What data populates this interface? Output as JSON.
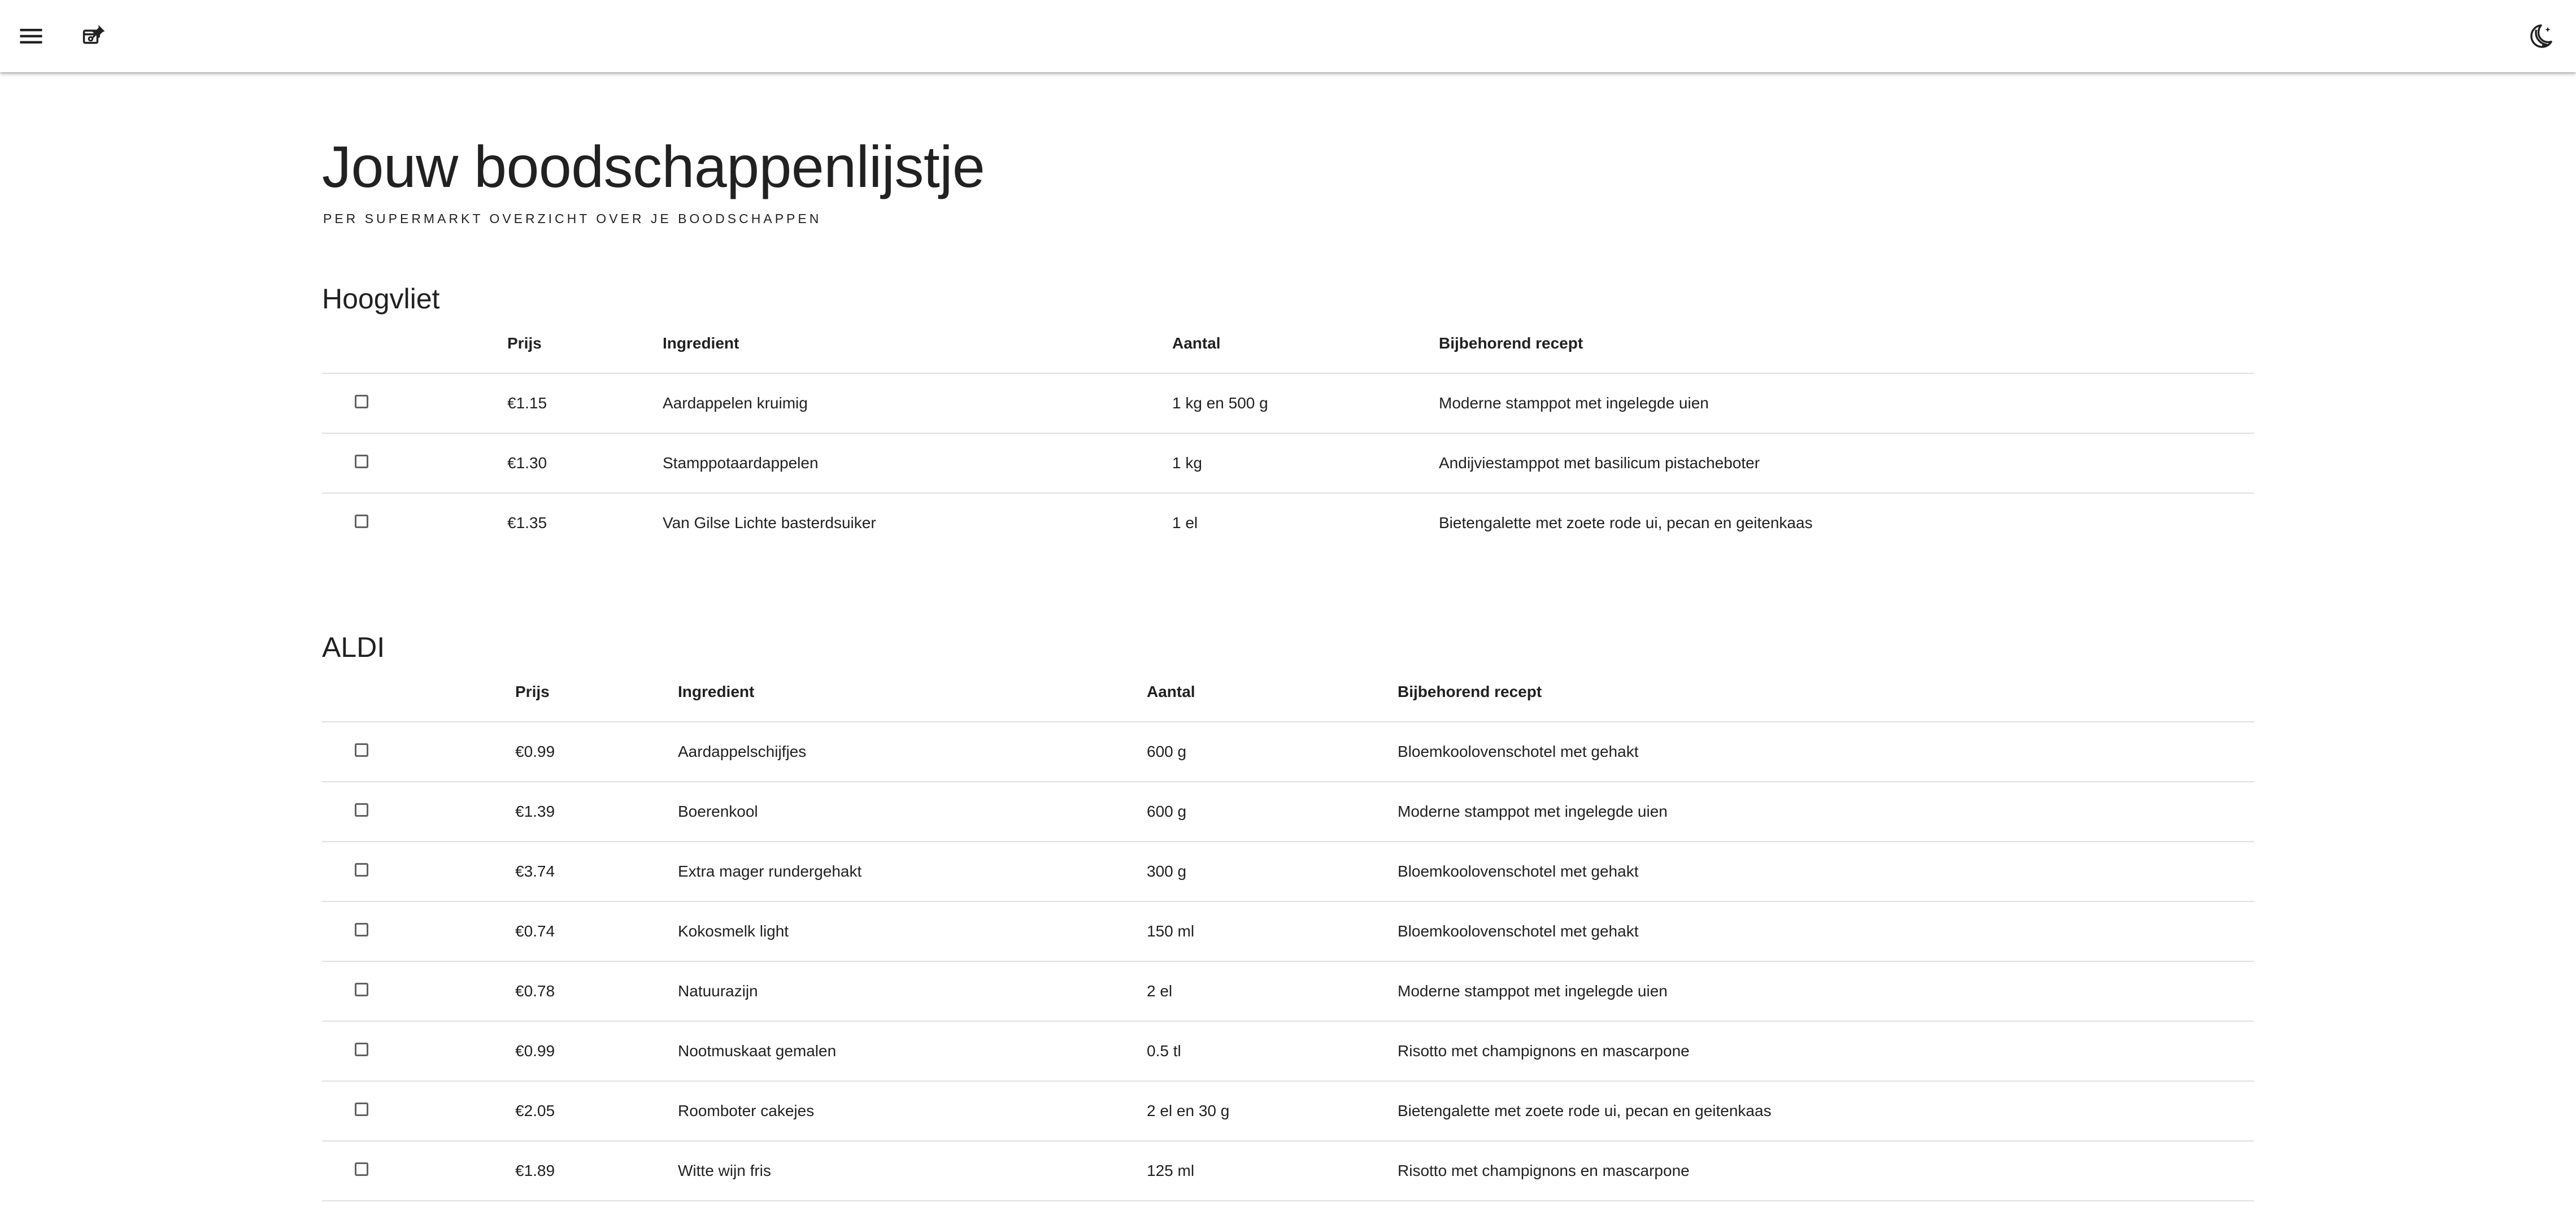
{
  "toolbar": {
    "menu_icon": "menu-icon",
    "pin_icon": "calendar-pin-icon",
    "theme_icon": "moon-icon"
  },
  "page": {
    "title": "Jouw boodschappenlijstje",
    "subtitle": "PER SUPERMARKT OVERZICHT OVER JE BOODSCHAPPEN"
  },
  "columns": {
    "prijs": "Prijs",
    "ingredient": "Ingredient",
    "aantal": "Aantal",
    "recept": "Bijbehorend recept"
  },
  "stores": [
    {
      "name": "Hoogvliet",
      "rows": [
        {
          "prijs": "€1.15",
          "ingredient": "Aardappelen kruimig",
          "aantal": "1 kg en 500 g",
          "recept": "Moderne stamppot met ingelegde uien",
          "checked": false
        },
        {
          "prijs": "€1.30",
          "ingredient": "Stamppotaardappelen",
          "aantal": "1 kg",
          "recept": "Andijviestamppot met basilicum pistacheboter",
          "checked": false
        },
        {
          "prijs": "€1.35",
          "ingredient": "Van Gilse Lichte basterdsuiker",
          "aantal": "1 el",
          "recept": "Bietengalette met zoete rode ui, pecan en geitenkaas",
          "checked": false
        }
      ]
    },
    {
      "name": "ALDI",
      "rows": [
        {
          "prijs": "€0.99",
          "ingredient": "Aardappelschijfjes",
          "aantal": "600 g",
          "recept": "Bloemkoolovenschotel met gehakt",
          "checked": false
        },
        {
          "prijs": "€1.39",
          "ingredient": "Boerenkool",
          "aantal": "600 g",
          "recept": "Moderne stamppot met ingelegde uien",
          "checked": false
        },
        {
          "prijs": "€3.74",
          "ingredient": "Extra mager rundergehakt",
          "aantal": "300 g",
          "recept": "Bloemkoolovenschotel met gehakt",
          "checked": false
        },
        {
          "prijs": "€0.74",
          "ingredient": "Kokosmelk light",
          "aantal": "150 ml",
          "recept": "Bloemkoolovenschotel met gehakt",
          "checked": false
        },
        {
          "prijs": "€0.78",
          "ingredient": "Natuurazijn",
          "aantal": "2 el",
          "recept": "Moderne stamppot met ingelegde uien",
          "checked": false
        },
        {
          "prijs": "€0.99",
          "ingredient": "Nootmuskaat gemalen",
          "aantal": "0.5 tl",
          "recept": "Risotto met champignons en mascarpone",
          "checked": false
        },
        {
          "prijs": "€2.05",
          "ingredient": "Roomboter cakejes",
          "aantal": "2 el en 30 g",
          "recept": "Bietengalette met zoete rode ui, pecan en geitenkaas",
          "checked": false
        },
        {
          "prijs": "€1.89",
          "ingredient": "Witte wijn fris",
          "aantal": "125 ml",
          "recept": "Risotto met champignons en mascarpone",
          "checked": false
        }
      ]
    }
  ]
}
